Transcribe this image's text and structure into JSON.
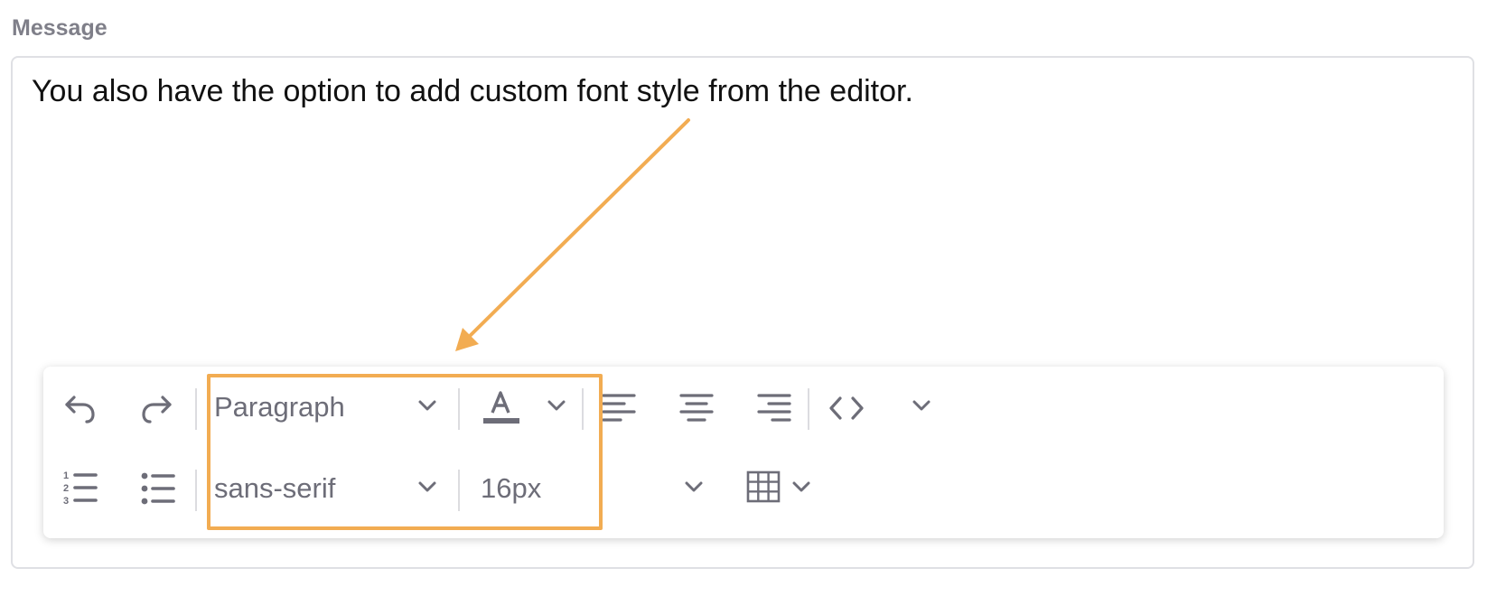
{
  "field": {
    "label": "Message",
    "content": "You also have the option to add custom font style from the editor."
  },
  "toolbar": {
    "row1": {
      "block_format": "Paragraph"
    },
    "row2": {
      "font_family": "sans-serif",
      "font_size": "16px"
    },
    "icons": [
      "undo-icon",
      "redo-icon",
      "text-color-icon",
      "align-left-icon",
      "align-center-icon",
      "align-right-icon",
      "code-icon",
      "chevron-down-icon",
      "numbered-list-icon",
      "bullet-list-icon",
      "table-icon"
    ]
  },
  "annotation": {
    "highlight_color": "#f2ac52"
  }
}
